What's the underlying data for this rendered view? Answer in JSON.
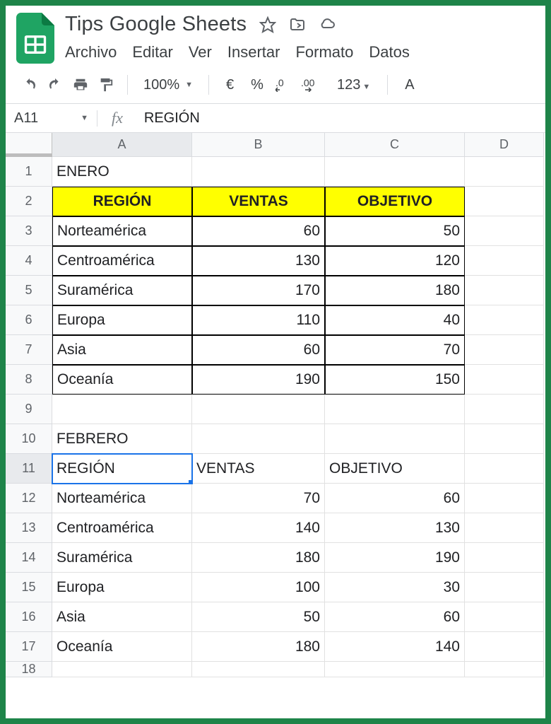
{
  "doc": {
    "title": "Tips Google Sheets"
  },
  "menus": {
    "file": "Archivo",
    "edit": "Editar",
    "view": "Ver",
    "insert": "Insertar",
    "format": "Formato",
    "data": "Datos"
  },
  "toolbar": {
    "zoom": "100%",
    "currency": "€",
    "percent": "%",
    "dec_less": ".0",
    "dec_more": ".00",
    "num_format": "123",
    "font_partial": "A"
  },
  "namebox": {
    "value": "A11"
  },
  "formula": {
    "value": "REGIÓN"
  },
  "columns": {
    "A": "A",
    "B": "B",
    "C": "C",
    "D": "D"
  },
  "rows": [
    "1",
    "2",
    "3",
    "4",
    "5",
    "6",
    "7",
    "8",
    "9",
    "10",
    "11",
    "12",
    "13",
    "14",
    "15",
    "16",
    "17",
    "18"
  ],
  "t1": {
    "title": "ENERO",
    "h": {
      "region": "REGIÓN",
      "ventas": "VENTAS",
      "objetivo": "OBJETIVO"
    },
    "r": [
      {
        "region": "Norteamérica",
        "ventas": "60",
        "objetivo": "50"
      },
      {
        "region": "Centroamérica",
        "ventas": "130",
        "objetivo": "120"
      },
      {
        "region": "Suramérica",
        "ventas": "170",
        "objetivo": "180"
      },
      {
        "region": "Europa",
        "ventas": "110",
        "objetivo": "40"
      },
      {
        "region": "Asia",
        "ventas": "60",
        "objetivo": "70"
      },
      {
        "region": "Oceanía",
        "ventas": "190",
        "objetivo": "150"
      }
    ]
  },
  "t2": {
    "title": "FEBRERO",
    "h": {
      "region": "REGIÓN",
      "ventas": "VENTAS",
      "objetivo": "OBJETIVO"
    },
    "r": [
      {
        "region": "Norteamérica",
        "ventas": "70",
        "objetivo": "60"
      },
      {
        "region": "Centroamérica",
        "ventas": "140",
        "objetivo": "130"
      },
      {
        "region": "Suramérica",
        "ventas": "180",
        "objetivo": "190"
      },
      {
        "region": "Europa",
        "ventas": "100",
        "objetivo": "30"
      },
      {
        "region": "Asia",
        "ventas": "50",
        "objetivo": "60"
      },
      {
        "region": "Oceanía",
        "ventas": "180",
        "objetivo": "140"
      }
    ]
  }
}
